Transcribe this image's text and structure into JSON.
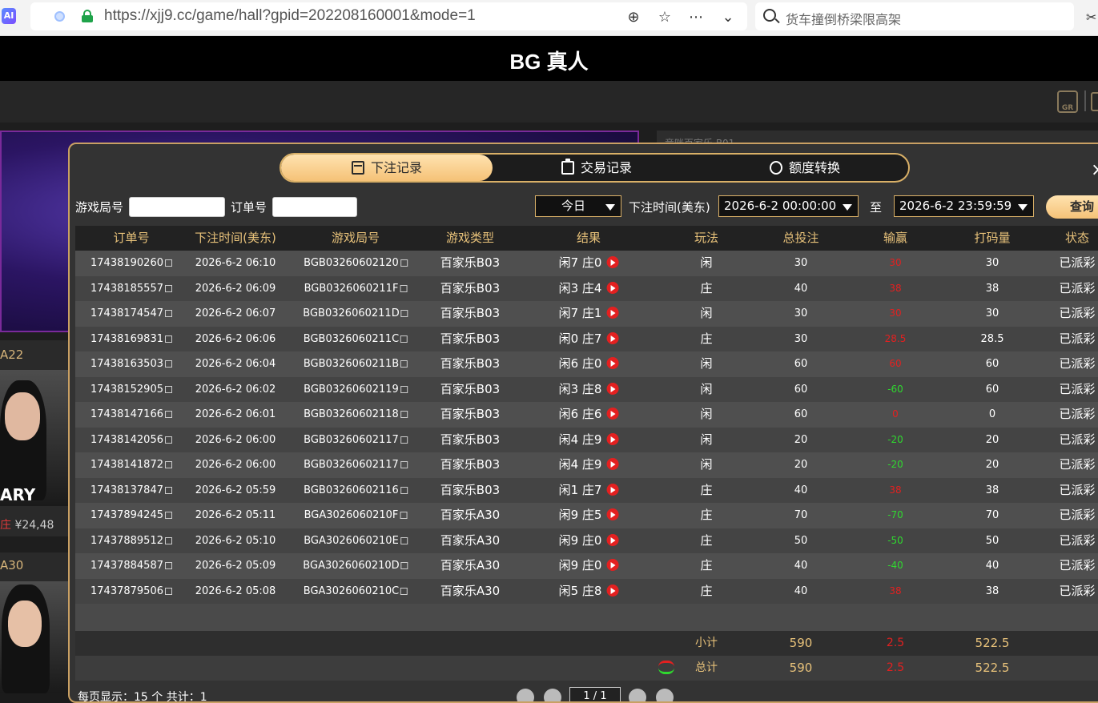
{
  "browser": {
    "badge": "AI",
    "url": "https://xjj9.cc/game/hall?gpid=202208160001&mode=1",
    "search_text": "货车撞倒桥梁限高架"
  },
  "app": {
    "title": "BG 真人"
  },
  "lobby": {
    "banner_strip": "竞咪百家乐 B01",
    "card1_label": "A22",
    "card1_name": "ARY",
    "card1_balance_tag": "庄",
    "card1_balance": "¥24,48",
    "card2_label": "A30"
  },
  "modal": {
    "tabs": [
      {
        "label": "下注记录",
        "active": true,
        "icon": "calendar-icon"
      },
      {
        "label": "交易记录",
        "active": false,
        "icon": "clipboard-icon"
      },
      {
        "label": "额度转换",
        "active": false,
        "icon": "coin-exchange-icon"
      }
    ],
    "close": "×",
    "filters": {
      "game_round_label": "游戏局号",
      "game_round_value": "",
      "order_label": "订单号",
      "order_value": "",
      "period": "今日",
      "time_label": "下注时间(美东)",
      "start_time": "2026-6-2 00:00:00",
      "to_label": "至",
      "end_time": "2026-6-2 23:59:59",
      "query": "查询"
    },
    "columns": [
      "订单号",
      "下注时间(美东)",
      "游戏局号",
      "游戏类型",
      "结果",
      "玩法",
      "总投注",
      "输赢",
      "打码量",
      "状态"
    ],
    "rows": [
      {
        "order": "17438190260",
        "time": "2026-6-2 06:10",
        "round": "BGB03260602120",
        "game": "百家乐B03",
        "result": "闲7 庄0",
        "play": "闲",
        "bet": "30",
        "winloss": "30",
        "wl_color": "red",
        "valid": "30",
        "status": "已派彩"
      },
      {
        "order": "17438185557",
        "time": "2026-6-2 06:09",
        "round": "BGB0326060211F",
        "game": "百家乐B03",
        "result": "闲3 庄4",
        "play": "庄",
        "bet": "40",
        "winloss": "38",
        "wl_color": "red",
        "valid": "38",
        "status": "已派彩"
      },
      {
        "order": "17438174547",
        "time": "2026-6-2 06:07",
        "round": "BGB0326060211D",
        "game": "百家乐B03",
        "result": "闲7 庄1",
        "play": "闲",
        "bet": "30",
        "winloss": "30",
        "wl_color": "red",
        "valid": "30",
        "status": "已派彩"
      },
      {
        "order": "17438169831",
        "time": "2026-6-2 06:06",
        "round": "BGB0326060211C",
        "game": "百家乐B03",
        "result": "闲0 庄7",
        "play": "庄",
        "bet": "30",
        "winloss": "28.5",
        "wl_color": "red",
        "valid": "28.5",
        "status": "已派彩"
      },
      {
        "order": "17438163503",
        "time": "2026-6-2 06:04",
        "round": "BGB0326060211B",
        "game": "百家乐B03",
        "result": "闲6 庄0",
        "play": "闲",
        "bet": "60",
        "winloss": "60",
        "wl_color": "red",
        "valid": "60",
        "status": "已派彩"
      },
      {
        "order": "17438152905",
        "time": "2026-6-2 06:02",
        "round": "BGB03260602119",
        "game": "百家乐B03",
        "result": "闲3 庄8",
        "play": "闲",
        "bet": "60",
        "winloss": "-60",
        "wl_color": "green",
        "valid": "60",
        "status": "已派彩"
      },
      {
        "order": "17438147166",
        "time": "2026-6-2 06:01",
        "round": "BGB03260602118",
        "game": "百家乐B03",
        "result": "闲6 庄6",
        "play": "闲",
        "bet": "60",
        "winloss": "0",
        "wl_color": "red",
        "valid": "0",
        "status": "已派彩"
      },
      {
        "order": "17438142056",
        "time": "2026-6-2 06:00",
        "round": "BGB03260602117",
        "game": "百家乐B03",
        "result": "闲4 庄9",
        "play": "闲",
        "bet": "20",
        "winloss": "-20",
        "wl_color": "green",
        "valid": "20",
        "status": "已派彩"
      },
      {
        "order": "17438141872",
        "time": "2026-6-2 06:00",
        "round": "BGB03260602117",
        "game": "百家乐B03",
        "result": "闲4 庄9",
        "play": "闲",
        "bet": "20",
        "winloss": "-20",
        "wl_color": "green",
        "valid": "20",
        "status": "已派彩"
      },
      {
        "order": "17438137847",
        "time": "2026-6-2 05:59",
        "round": "BGB03260602116",
        "game": "百家乐B03",
        "result": "闲1 庄7",
        "play": "庄",
        "bet": "40",
        "winloss": "38",
        "wl_color": "red",
        "valid": "38",
        "status": "已派彩"
      },
      {
        "order": "17437894245",
        "time": "2026-6-2 05:11",
        "round": "BGA3026060210F",
        "game": "百家乐A30",
        "result": "闲9 庄5",
        "play": "庄",
        "bet": "70",
        "winloss": "-70",
        "wl_color": "green",
        "valid": "70",
        "status": "已派彩"
      },
      {
        "order": "17437889512",
        "time": "2026-6-2 05:10",
        "round": "BGA3026060210E",
        "game": "百家乐A30",
        "result": "闲9 庄0",
        "play": "庄",
        "bet": "50",
        "winloss": "-50",
        "wl_color": "green",
        "valid": "50",
        "status": "已派彩"
      },
      {
        "order": "17437884587",
        "time": "2026-6-2 05:09",
        "round": "BGA3026060210D",
        "game": "百家乐A30",
        "result": "闲9 庄0",
        "play": "庄",
        "bet": "40",
        "winloss": "-40",
        "wl_color": "green",
        "valid": "40",
        "status": "已派彩"
      },
      {
        "order": "17437879506",
        "time": "2026-6-2 05:08",
        "round": "BGA3026060210C",
        "game": "百家乐A30",
        "result": "闲5 庄8",
        "play": "庄",
        "bet": "40",
        "winloss": "38",
        "wl_color": "red",
        "valid": "38",
        "status": "已派彩"
      }
    ],
    "subtotal": {
      "label": "小计",
      "bet": "590",
      "winloss": "2.5",
      "valid": "522.5"
    },
    "total": {
      "label": "总计",
      "bet": "590",
      "winloss": "2.5",
      "valid": "522.5"
    },
    "pager": {
      "text": "每页显示：15 个  共计：1",
      "page": "1 / 1"
    }
  }
}
